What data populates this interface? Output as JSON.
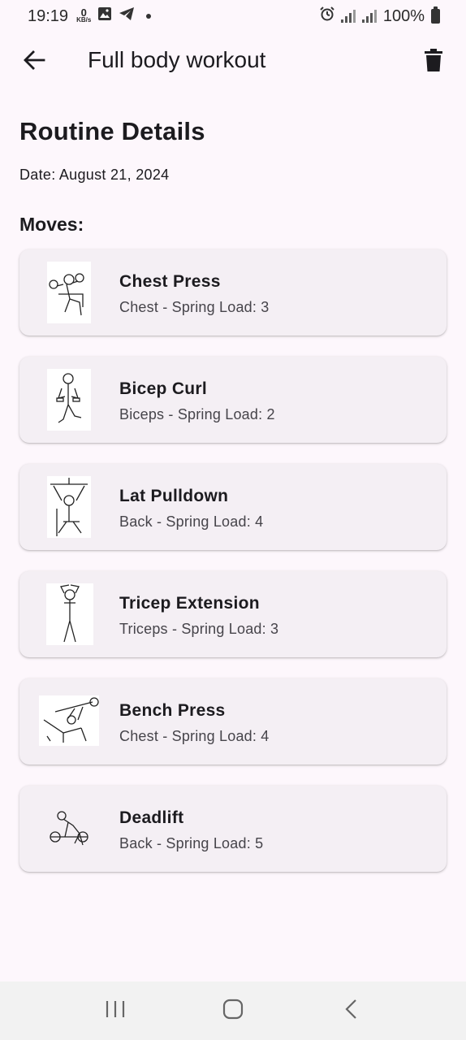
{
  "status_bar": {
    "time": "19:19",
    "net_speed_value": "0",
    "net_speed_unit": "KB/s",
    "battery": "100%",
    "icons": [
      "gallery-icon",
      "telegram-icon",
      "notification-dot",
      "alarm-icon",
      "signal-icon",
      "signal-icon",
      "battery-icon"
    ]
  },
  "app_bar": {
    "title": "Full body workout",
    "back_icon": "arrow-back-icon",
    "delete_icon": "trash-icon"
  },
  "page": {
    "heading": "Routine Details",
    "date": "Date: August 21, 2024",
    "moves_label": "Moves:"
  },
  "moves": [
    {
      "name": "Chest Press",
      "detail": "Chest - Spring Load: 3",
      "image": "chest-press-illustration"
    },
    {
      "name": "Bicep Curl",
      "detail": "Biceps - Spring Load: 2",
      "image": "bicep-curl-illustration"
    },
    {
      "name": "Lat Pulldown",
      "detail": "Back - Spring Load: 4",
      "image": "lat-pulldown-illustration"
    },
    {
      "name": "Tricep Extension",
      "detail": "Triceps - Spring Load: 3",
      "image": "tricep-extension-illustration"
    },
    {
      "name": "Bench Press",
      "detail": "Chest - Spring Load: 4",
      "image": "bench-press-illustration"
    },
    {
      "name": "Deadlift",
      "detail": "Back - Spring Load: 5",
      "image": "deadlift-illustration"
    }
  ],
  "nav_bar": {
    "icons": [
      "recent-apps-icon",
      "home-icon",
      "back-icon"
    ]
  },
  "colors": {
    "background": "#fdf7fc",
    "card": "#f4eff4",
    "text_primary": "#1c1b1f",
    "text_secondary": "#46444a",
    "nav_bar": "#f2f2f2"
  }
}
